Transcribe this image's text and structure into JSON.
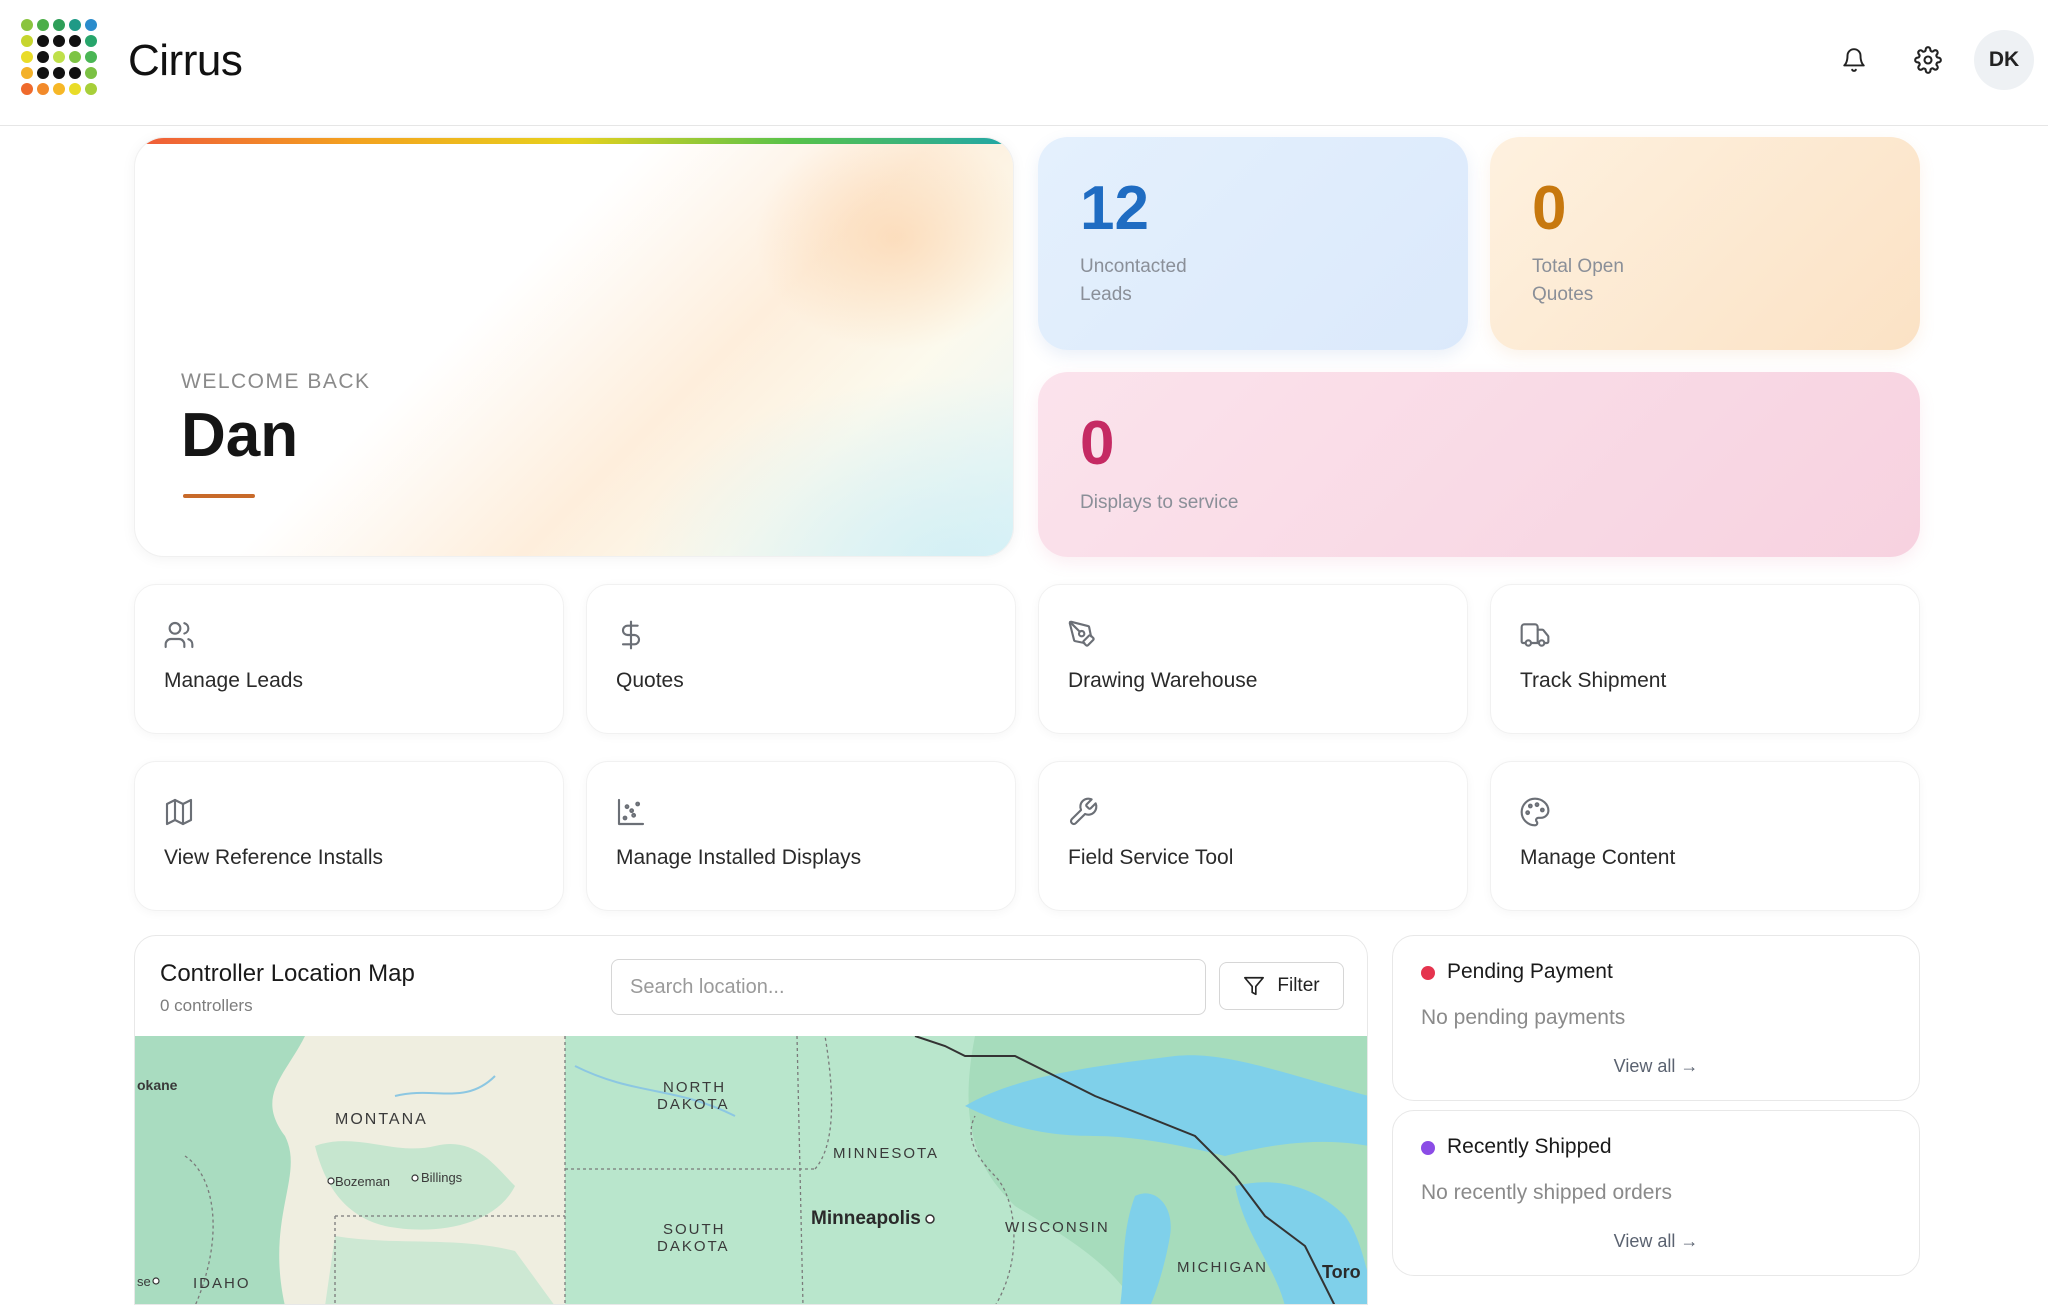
{
  "header": {
    "brand": "Cirrus",
    "user_initials": "DK",
    "icons": [
      "bell-icon",
      "gear-icon"
    ]
  },
  "welcome": {
    "eyebrow": "WELCOME BACK",
    "name": "Dan"
  },
  "stats": {
    "uncontacted_leads": {
      "value": "12",
      "label_line1": "Uncontacted",
      "label_line2": "Leads",
      "color": "#1f6cc2"
    },
    "total_open_quotes": {
      "value": "0",
      "label_line1": "Total Open",
      "label_line2": "Quotes",
      "color": "#c7780e"
    },
    "displays_to_service": {
      "value": "0",
      "label": "Displays to service",
      "color": "#c52a63"
    }
  },
  "actions": [
    {
      "label": "Manage Leads",
      "icon": "users-icon"
    },
    {
      "label": "Quotes",
      "icon": "dollar-icon"
    },
    {
      "label": "Drawing Warehouse",
      "icon": "pen-tool-icon"
    },
    {
      "label": "Track Shipment",
      "icon": "truck-icon"
    },
    {
      "label": "View Reference Installs",
      "icon": "map-icon"
    },
    {
      "label": "Manage Installed Displays",
      "icon": "chart-scatter-icon"
    },
    {
      "label": "Field Service Tool",
      "icon": "wrench-icon"
    },
    {
      "label": "Manage Content",
      "icon": "palette-icon"
    }
  ],
  "map_panel": {
    "title": "Controller Location Map",
    "subtitle": "0 controllers",
    "search_placeholder": "Search location...",
    "filter_label": "Filter",
    "labels": {
      "spokane": "okane",
      "montana": "MONTANA",
      "north_dakota_1": "NORTH",
      "north_dakota_2": "DAKOTA",
      "minnesota": "MINNESOTA",
      "bozeman": "Bozeman",
      "billings": "Billings",
      "minneapolis": "Minneapolis",
      "south_dakota_1": "SOUTH",
      "south_dakota_2": "DAKOTA",
      "wisconsin": "WISCONSIN",
      "michigan": "MICHIGAN",
      "idaho": "IDAHO",
      "boise": "se",
      "toronto": "Toro"
    }
  },
  "pending_payment": {
    "title": "Pending Payment",
    "empty": "No pending payments",
    "view_all": "View all →",
    "dot_color": "#e5344e"
  },
  "recently_shipped": {
    "title": "Recently Shipped",
    "empty": "No recently shipped orders",
    "view_all": "View all →",
    "dot_color": "#8b4ce6"
  }
}
